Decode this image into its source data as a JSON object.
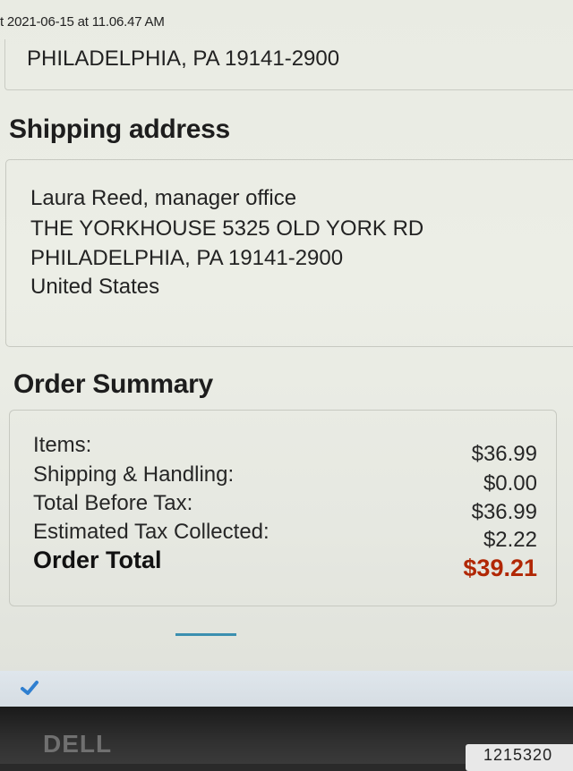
{
  "caption": "t 2021-06-15 at 11.06.47 AM",
  "billing": {
    "last_line": "PHILADELPHIA, PA 19141-2900"
  },
  "shipping": {
    "heading": "Shipping address",
    "lines": [
      "Laura Reed, manager office",
      "THE YORKHOUSE 5325 OLD YORK RD",
      "PHILADELPHIA, PA 19141-2900",
      "United States"
    ]
  },
  "summary": {
    "heading": "Order Summary",
    "rows": [
      {
        "label": "Items:",
        "value": "$36.99"
      },
      {
        "label": "Shipping & Handling:",
        "value": "$0.00"
      },
      {
        "label": "Total Before Tax:",
        "value": "$36.99"
      },
      {
        "label": "Estimated Tax Collected:",
        "value": "$2.22"
      }
    ],
    "total_label": "Order Total",
    "total_value": "$39.21",
    "total_color": "#b12704"
  },
  "taskbar": {
    "icon": "check-icon"
  },
  "monitor": {
    "brand": "DELL",
    "sticker": "1215320"
  }
}
